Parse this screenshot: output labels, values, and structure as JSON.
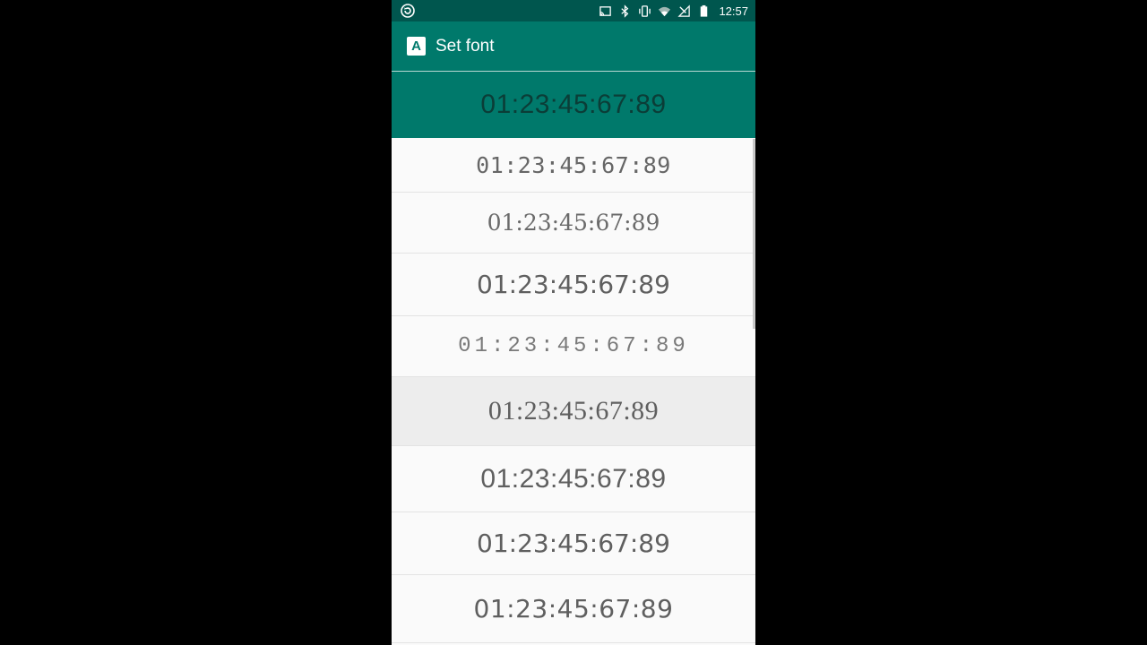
{
  "status_bar": {
    "time": "12:57",
    "left_icon": "sync-icon",
    "right_icons": [
      "cast-icon",
      "bluetooth-icon",
      "vibrate-icon",
      "wifi-icon",
      "no-signal-icon",
      "battery-icon"
    ]
  },
  "app_bar": {
    "icon_letter": "A",
    "title": "Set font"
  },
  "font_list": {
    "items": [
      {
        "sample": "01:23:45:67:89",
        "state": "selected"
      },
      {
        "sample": "01:23:45:67:89",
        "state": "normal"
      },
      {
        "sample": "01:23:45:67:89",
        "state": "normal"
      },
      {
        "sample": "01:23:45:67:89",
        "state": "normal"
      },
      {
        "sample": "01:23:45:67:89",
        "state": "normal"
      },
      {
        "sample": "01:23:45:67:89",
        "state": "pressed"
      },
      {
        "sample": "01:23:45:67:89",
        "state": "normal"
      },
      {
        "sample": "01:23:45:67:89",
        "state": "normal"
      },
      {
        "sample": "01:23:45:67:89",
        "state": "normal"
      }
    ]
  },
  "colors": {
    "status_bar": "#00564e",
    "app_bar": "#00796b",
    "selected_row": "#00796b",
    "pressed_row": "#ededed",
    "list_background": "#fafafa",
    "outside": "#000000"
  }
}
